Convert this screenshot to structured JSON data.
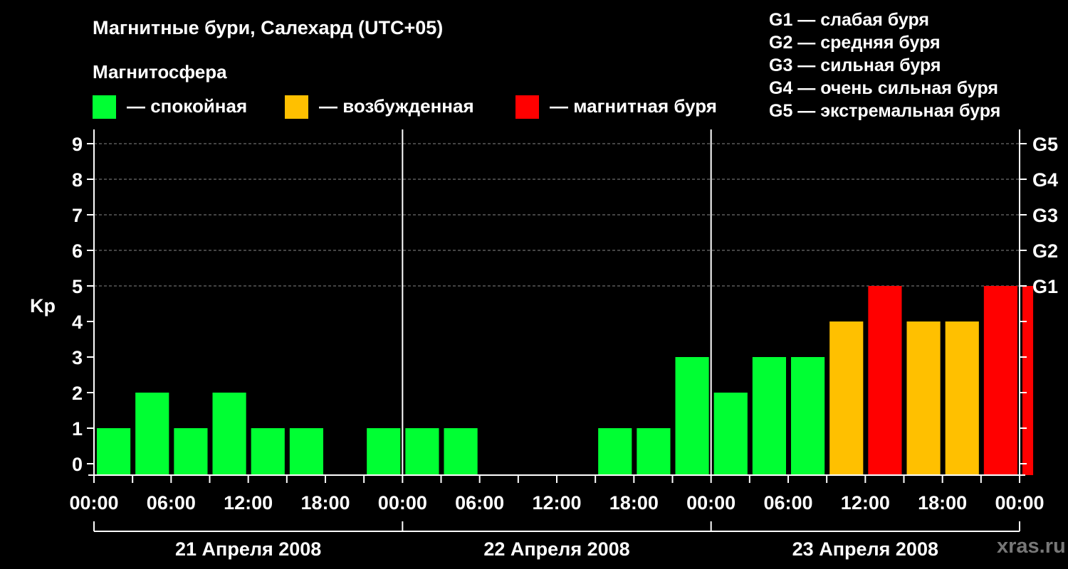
{
  "header": {
    "title": "Магнитные бури, Салехард (UTC+05)",
    "subtitle": "Магнитосфера"
  },
  "legend": {
    "items": [
      {
        "label": "— спокойная",
        "color": "#00ff33"
      },
      {
        "label": "— возбужденная",
        "color": "#ffc000"
      },
      {
        "label": "— магнитная буря",
        "color": "#ff0000"
      }
    ]
  },
  "g_legend": [
    "G1 — слабая буря",
    "G2 — средняя буря",
    "G3 — сильная буря",
    "G4 — очень сильная буря",
    "G5 — экстремальная буря"
  ],
  "watermark": "xras.ru",
  "colors": {
    "quiet": "#00ff33",
    "active": "#ffc000",
    "storm": "#ff0000"
  },
  "chart_data": {
    "type": "bar",
    "ylabel": "Kp",
    "ylim": [
      0,
      9
    ],
    "yticks": [
      "0",
      "1",
      "2",
      "3",
      "4",
      "5",
      "6",
      "7",
      "8",
      "9"
    ],
    "right_ticks": [
      {
        "value": 5,
        "label": "G1"
      },
      {
        "value": 6,
        "label": "G2"
      },
      {
        "value": 7,
        "label": "G3"
      },
      {
        "value": 8,
        "label": "G4"
      },
      {
        "value": 9,
        "label": "G5"
      }
    ],
    "x_ticks": [
      "00:00",
      "06:00",
      "12:00",
      "18:00",
      "00:00",
      "06:00",
      "12:00",
      "18:00",
      "00:00",
      "06:00",
      "12:00",
      "18:00",
      "00:00"
    ],
    "dates": [
      "21 Апреля 2008",
      "22 Апреля 2008",
      "23 Апреля 2008"
    ],
    "hours_per_bar": 3,
    "values": [
      1,
      2,
      1,
      2,
      1,
      1,
      0,
      1,
      1,
      1,
      0,
      0,
      0,
      1,
      1,
      3,
      2,
      3,
      3,
      4,
      5,
      4,
      4,
      5
    ],
    "partial_last": {
      "value": 5,
      "hours": 1
    }
  }
}
